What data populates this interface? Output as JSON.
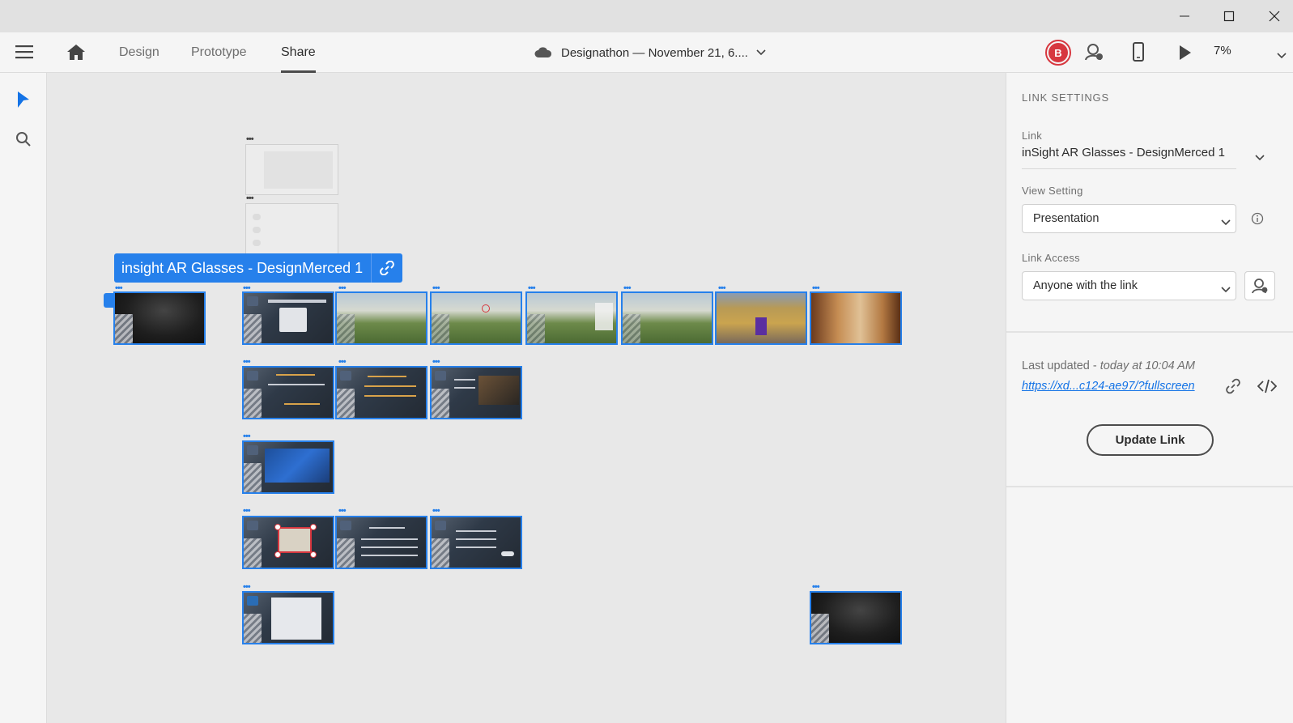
{
  "window": {
    "minimize_icon": "minimize-icon",
    "maximize_icon": "maximize-icon",
    "close_icon": "close-icon"
  },
  "topbar": {
    "tabs": [
      {
        "label": "Design"
      },
      {
        "label": "Prototype"
      },
      {
        "label": "Share",
        "active": true
      }
    ],
    "document_title": "Designathon — November 21, 6....",
    "avatar_letter": "B",
    "zoom": "7%"
  },
  "canvas": {
    "link_badge_label": "insight AR Glasses - DesignMerced 1"
  },
  "panel": {
    "heading": "LINK SETTINGS",
    "link_label": "Link",
    "link_value": "inSight AR Glasses - DesignMerced 1",
    "view_setting_label": "View Setting",
    "view_setting_value": "Presentation",
    "link_access_label": "Link Access",
    "link_access_value": "Anyone with the link",
    "last_updated_prefix": "Last updated - ",
    "last_updated_time": "today at 10:04 AM",
    "url": "https://xd...c124-ae97/?fullscreen",
    "update_button": "Update Link"
  },
  "colors": {
    "accent": "#2680eb",
    "avatar_ring": "#d7373f"
  }
}
